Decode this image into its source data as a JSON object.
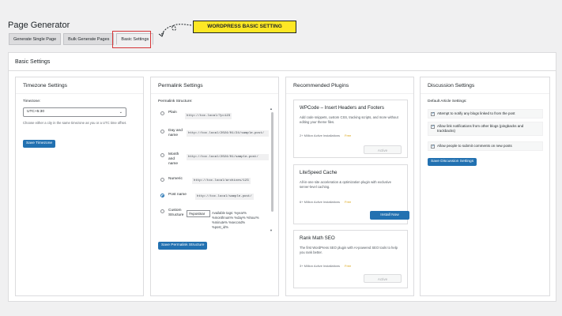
{
  "page": {
    "title": "Page Generator"
  },
  "tabs": [
    {
      "label": "Generate Single Page"
    },
    {
      "label": "Bulk Generate Pages"
    },
    {
      "label": "Basic Settings"
    }
  ],
  "callout": {
    "label": "WORDPRESS BASIC SETTING"
  },
  "main": {
    "heading": "Basic Settings"
  },
  "timezone": {
    "title": "Timezone Settings",
    "field_label": "Timezone:",
    "value": "UTC+5:30",
    "help": "Choose either a city in the same timezone as you or a UTC time offset.",
    "button": "Save Timezone"
  },
  "permalink": {
    "title": "Permalink Settings",
    "structure_label": "Permalink Structure:",
    "options": [
      {
        "label": "Plain",
        "example": "http://toc.local/?p=123",
        "selected": false
      },
      {
        "label": "Day and name",
        "example": "http://toc.local/2024/01/24/sample-post/",
        "selected": false
      },
      {
        "label": "Month and name",
        "example": "http://toc.local/2024/01/sample-post/",
        "selected": false
      },
      {
        "label": "Numeric",
        "example": "http://toc.local/archives/123",
        "selected": false
      },
      {
        "label": "Post name",
        "example": "http://toc.local/sample-post/",
        "selected": true
      },
      {
        "label": "Custom Structure",
        "example": "/%postnar",
        "selected": false
      }
    ],
    "available_tags": "Available tags: %year% %monthnum% %day% %hour% %minute% %second% %post_id%",
    "button": "Save Permalink Structure"
  },
  "plugins": {
    "title": "Recommended Plugins",
    "items": [
      {
        "name": "WPCode – Insert Headers and Footers",
        "desc": "Add code snippets, custom CSS, tracking scripts, and more without editing your theme files.",
        "installs": "2+ Million Active Installations",
        "price": "Free",
        "action": "Active",
        "active": true
      },
      {
        "name": "LiteSpeed Cache",
        "desc": "All-in-one site acceleration & optimization plugin with exclusive server-level caching.",
        "installs": "6+ Million Active Installations",
        "price": "Free",
        "action": "Install Now",
        "active": false
      },
      {
        "name": "Rank Math SEO",
        "desc": "The first WordPress SEO plugin with AI-powered SEO tools to help you rank better.",
        "installs": "3+ Million Active Installations",
        "price": "Free",
        "action": "Active",
        "active": true
      }
    ]
  },
  "discussion": {
    "title": "Discussion Settings",
    "default_label": "Default Article Settings:",
    "options": [
      {
        "label": "Attempt to notify any blogs linked to from the post",
        "checked": true
      },
      {
        "label": "Allow link notifications from other blogs (pingbacks and trackbacks)",
        "checked": true
      },
      {
        "label": "Allow people to submit comments on new posts",
        "checked": true
      }
    ],
    "button": "Save Discussion Settings"
  },
  "colors": {
    "primary": "#2271b1",
    "highlight": "#d63638",
    "callout": "#fde725",
    "free": "#dba617"
  }
}
